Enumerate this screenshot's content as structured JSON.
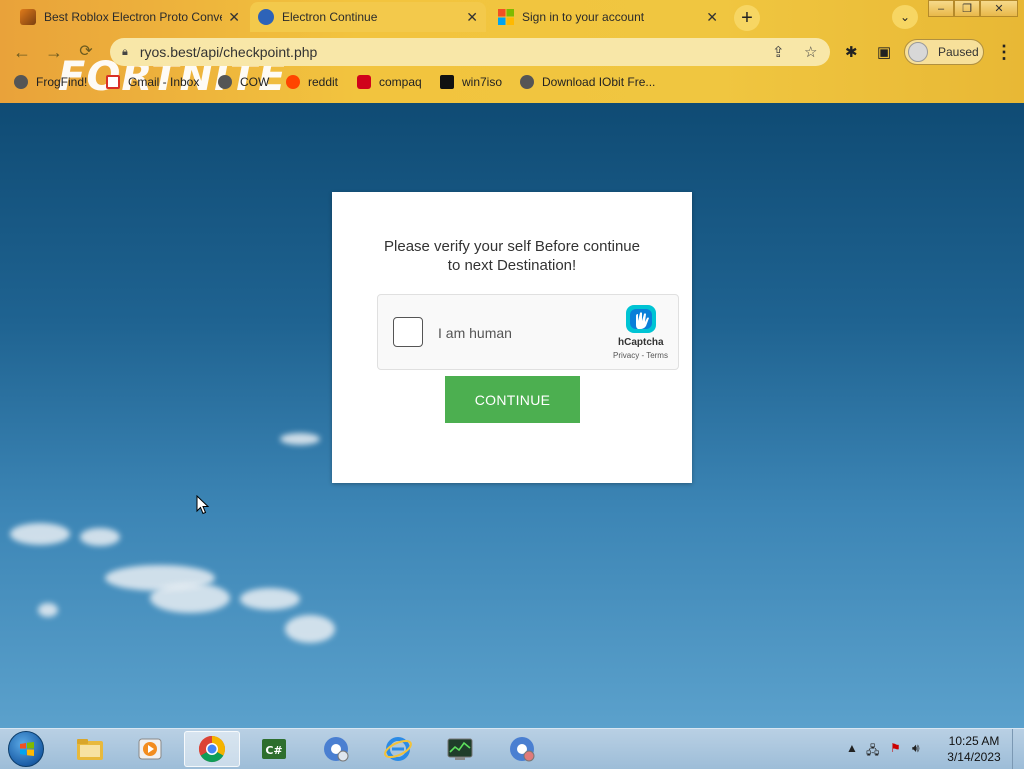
{
  "browser": {
    "tabs": [
      {
        "title": "Best Roblox Electron Proto Conve",
        "active": false
      },
      {
        "title": "Electron Continue",
        "active": true
      },
      {
        "title": "Sign in to your account",
        "active": false
      }
    ],
    "theme_text": "FORTNITE",
    "url": "ryos.best/api/checkpoint.php",
    "profile_label": "Paused",
    "bookmarks": [
      "FrogFind!",
      "Gmail - Inbox",
      "COW",
      "reddit",
      "compaq",
      "win7iso",
      "Download IObit Fre..."
    ]
  },
  "page": {
    "message_line1": "Please verify your self Before continue",
    "message_line2": "to next Destination!",
    "captcha": {
      "label": "I am human",
      "brand": "hCaptcha",
      "terms": "Privacy - Terms"
    },
    "continue_label": "CONTINUE",
    "colors": {
      "button": "#4caf50",
      "card": "#ffffff"
    }
  },
  "taskbar": {
    "time": "10:25 AM",
    "date": "3/14/2023"
  }
}
